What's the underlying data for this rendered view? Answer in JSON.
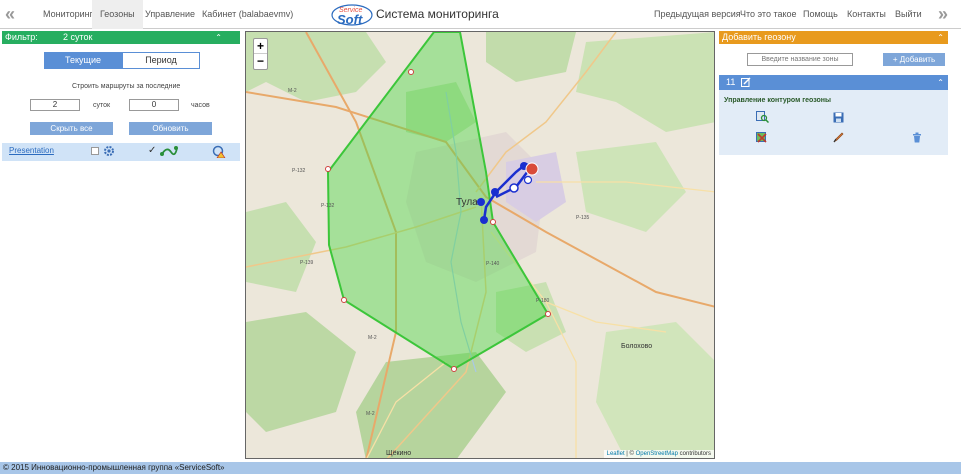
{
  "nav": {
    "items": [
      "Мониторинг",
      "Геозоны",
      "Управление",
      "Кабинет (balabaevmv)"
    ],
    "right_items": [
      "Предыдущая версия",
      "Что это такое",
      "Помощь",
      "Контакты",
      "Выйти"
    ],
    "logo_text_top": "Service",
    "logo_text_bottom": "Soft",
    "title": "Система мониторинга"
  },
  "filter": {
    "label": "Фильтр:",
    "period": "2 суток",
    "tab_current": "Текущие",
    "tab_period": "Период",
    "routes_label": "Строить маршруты за последние",
    "days_value": "2",
    "days_unit": "суток",
    "hours_value": "0",
    "hours_unit": "часов",
    "hide_all": "Скрыть все",
    "refresh": "Обновить",
    "presentation": "Presentation"
  },
  "map": {
    "zoom_in": "+",
    "zoom_out": "−",
    "labels": {
      "city": "Тула",
      "bolokhovo": "Болохово",
      "shchekino": "Щёкино",
      "road_p132a": "Р-132",
      "road_p132b": "Р-132",
      "road_p139": "Р-139",
      "road_p140": "Р-140",
      "road_p135": "Р-135",
      "road_m2a": "М-2",
      "road_m2b": "М-2",
      "road_m2c": "М-2",
      "road_p180": "Р-180"
    },
    "attribution_leaflet": "Leaflet",
    "attribution_sep": " | © ",
    "attribution_osm": "OpenStreetMap",
    "attribution_tail": " contributors"
  },
  "geozone": {
    "add_header": "Добавить геозону",
    "name_placeholder": "Введите название зоны",
    "add_button": "Добавить",
    "zone_id": "11",
    "contour_title": "Управление контуром геозоны"
  },
  "footer": {
    "text": "© 2015 Инновационно-промышленная группа «ServiceSoft»"
  },
  "colors": {
    "filter_green": "#27ae60",
    "accent_blue": "#5a8fd6",
    "orange": "#e89a1e",
    "geozone_fill": "#4fd64a",
    "route": "#1a2fcf"
  }
}
